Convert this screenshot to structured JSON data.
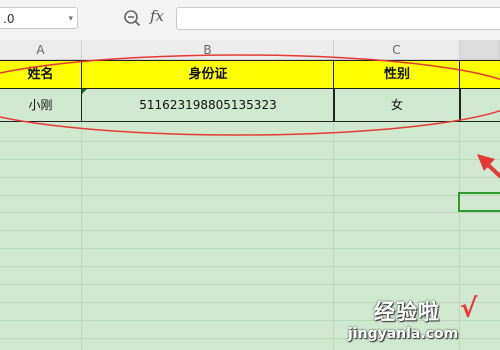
{
  "formula_bar": {
    "name_box_value": ".0",
    "fx_label": "fx",
    "formula_value": ""
  },
  "columns": [
    "A",
    "B",
    "C"
  ],
  "table": {
    "headers": [
      "姓名",
      "身份证",
      "性别"
    ],
    "rows": [
      [
        "小刚",
        "511623198805135323",
        "女"
      ]
    ]
  },
  "watermark": {
    "title": "经验啦",
    "domain": "jingyanla.com"
  },
  "colors": {
    "sheet_bg": "#cfe8cf",
    "header_fill": "#ffff00",
    "annotation_red": "#e53935",
    "selection_green": "#2e9a2e"
  },
  "icons": [
    "zoom-icon",
    "fx-icon",
    "chevron-down-icon",
    "check-icon"
  ]
}
